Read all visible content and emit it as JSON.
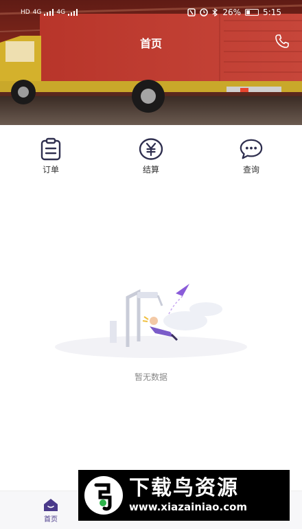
{
  "status_bar": {
    "left_badges": [
      "HD",
      "HD"
    ],
    "left_net": [
      "4G",
      "4G"
    ],
    "battery": "26%",
    "time": "5:15",
    "battery_level": 0.26
  },
  "header": {
    "title": "首页",
    "phone_icon": "phone-icon"
  },
  "actions": [
    {
      "label": "订单",
      "icon": "clipboard-icon"
    },
    {
      "label": "结算",
      "icon": "yen-icon"
    },
    {
      "label": "查询",
      "icon": "chat-icon"
    }
  ],
  "empty_state": {
    "text": "暂无数据"
  },
  "bottom_nav": {
    "home_label": "首页",
    "home_icon": "home-icon"
  },
  "watermark": {
    "brand": "下载鸟资源",
    "url": "www.xiazainiao.com"
  },
  "colors": {
    "accent": "#4a3a8a",
    "icon": "#2f2f4f",
    "muted": "#888888"
  }
}
